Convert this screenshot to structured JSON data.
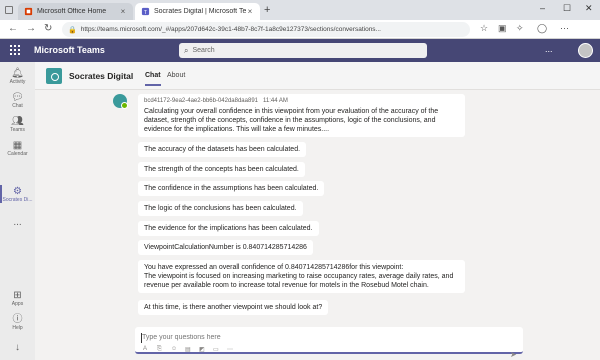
{
  "browser": {
    "tabs": [
      {
        "title": "Microsoft Office Home",
        "icon": "office-icon",
        "active": false
      },
      {
        "title": "Socrates Digital | Microsoft Teams",
        "icon": "teams-icon",
        "active": true
      }
    ],
    "url": "https://teams.microsoft.com/_#/apps/207d642c-39c1-48b7-8c7f-1a8c9e127373/sections/conversations..."
  },
  "teams": {
    "app_title": "Microsoft Teams",
    "search_placeholder": "Search",
    "more_label": "...",
    "brand_color": "#464775"
  },
  "rail": {
    "items": [
      {
        "label": "Activity",
        "icon": "bell-icon"
      },
      {
        "label": "Chat",
        "icon": "chat-icon"
      },
      {
        "label": "Teams",
        "icon": "teams-icon"
      },
      {
        "label": "Calendar",
        "icon": "calendar-icon"
      },
      {
        "label": "Socrates Di...",
        "icon": "bot-icon",
        "active": true
      },
      {
        "label": "...",
        "icon": "more-icon"
      },
      {
        "label": "Apps",
        "icon": "apps-icon"
      },
      {
        "label": "Help",
        "icon": "help-icon"
      }
    ]
  },
  "channel": {
    "name": "Socrates Digital",
    "tabs": [
      "Chat",
      "About"
    ]
  },
  "messages": {
    "sender": "bcd41172-9ea2-4ae2-bb6b-042da8daa891",
    "time": "11:44 AM",
    "first_lines": [
      "Calculating your overall confidence in this viewpoint from your evaluation of the accuracy of the",
      "dataset, strength of the concepts, confidence in the assumptions, logic of the conclusions, and",
      "evidence for the implications.  This will take a few minutes...."
    ],
    "status": [
      "The accuracy of the datasets has been calculated.",
      "The strength of the concepts has been calculated.",
      "The confidence in the assumptions has been calculated.",
      "The logic of the conclusions has been calculated.",
      "The evidence for the implications has been calculated.",
      "ViewpointCalculationNumber is 0.840714285714286"
    ],
    "summary_lines": [
      "You have expressed an overall confidence of 0.840714285714286for this viewpoint:",
      "The viewpoint is focused on increasing marketing to raise occupancy rates, average daily rates, and",
      "revenue per available room to increase total revenue for motels in the Rosebud Motel chain."
    ],
    "question": "At this time, is there another viewpoint we should look at?"
  },
  "compose": {
    "placeholder": "Type your questions here"
  }
}
